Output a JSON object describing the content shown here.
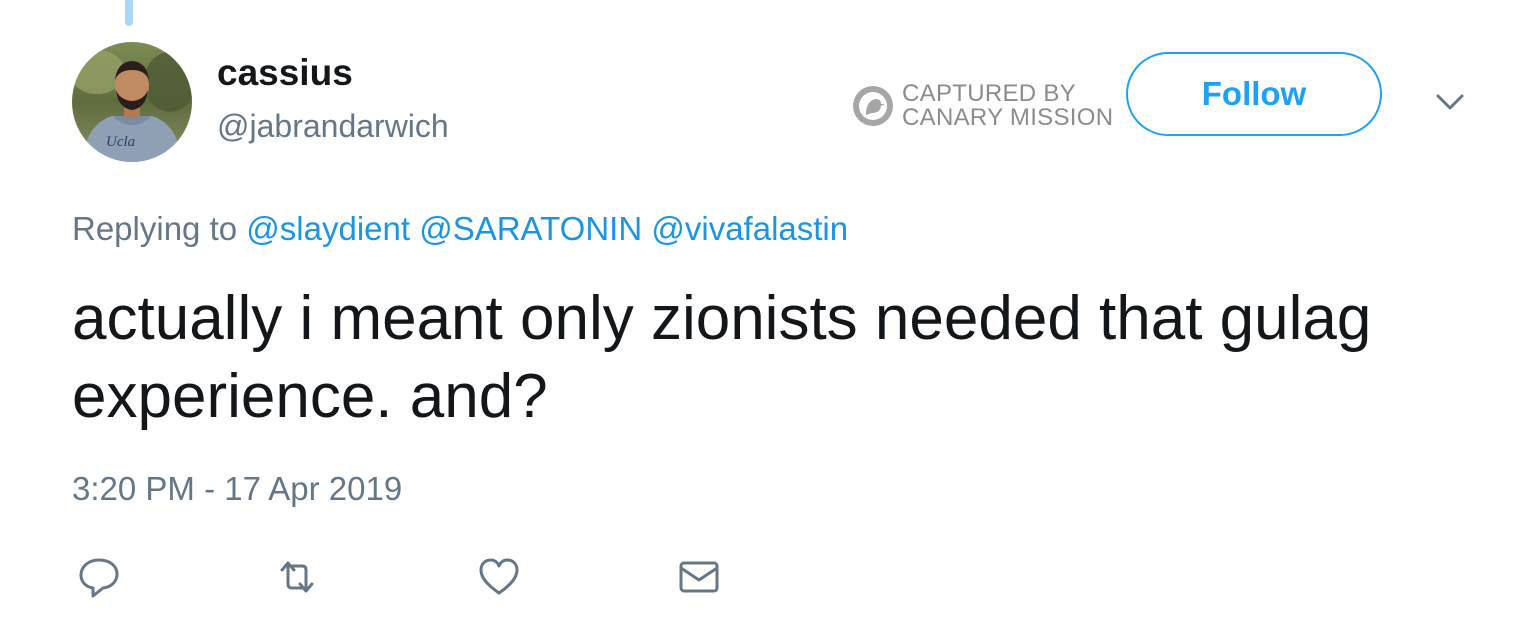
{
  "tweet": {
    "author": {
      "display_name": "cassius",
      "handle": "@jabrandarwich",
      "avatar_icon": "user-avatar-photo"
    },
    "watermark": {
      "line1": "CAPTURED BY",
      "line2": "CANARY MISSION"
    },
    "follow_label": "Follow",
    "replying_to": {
      "prefix": "Replying to",
      "mentions": [
        "@slaydient",
        "@SARATONIN",
        "@vivafalastin"
      ]
    },
    "text": "actually i meant only zionists needed that gulag experience. and?",
    "timestamp": "3:20 PM - 17 Apr 2019",
    "actions": [
      {
        "name": "reply",
        "icon": "reply-icon"
      },
      {
        "name": "retweet",
        "icon": "retweet-icon"
      },
      {
        "name": "like",
        "icon": "heart-icon"
      },
      {
        "name": "direct-message",
        "icon": "envelope-icon"
      }
    ]
  },
  "colors": {
    "accent": "#1da1f2",
    "link": "#1b95e0",
    "secondary_text": "#657786",
    "primary_text": "#14171a",
    "thread_line": "#a9d7f8"
  }
}
